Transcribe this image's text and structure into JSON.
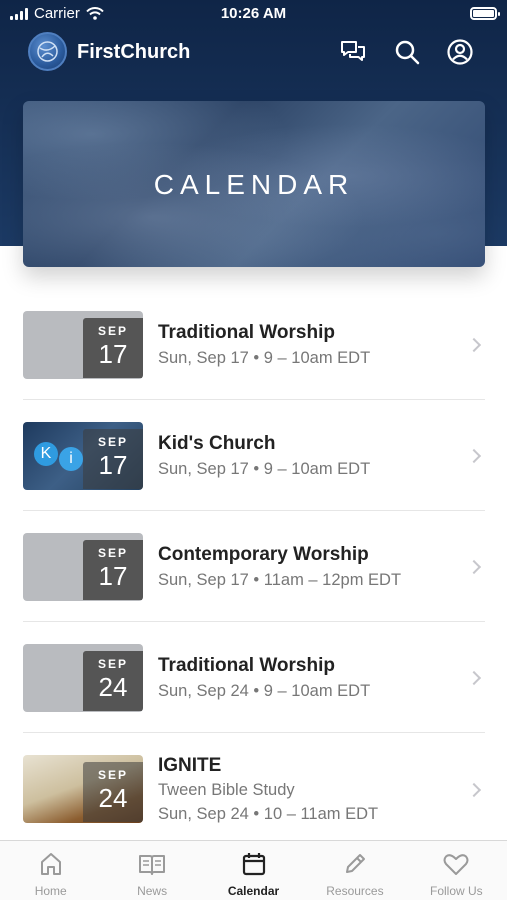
{
  "status_bar": {
    "carrier": "Carrier",
    "time": "10:26 AM"
  },
  "header": {
    "title": "FirstChurch"
  },
  "hero": {
    "title": "CALENDAR"
  },
  "events": [
    {
      "month": "SEP",
      "day": "17",
      "title": "Traditional Worship",
      "line1": "Sun, Sep 17 • 9 – 10am EDT",
      "line2": "",
      "thumb": "gray"
    },
    {
      "month": "SEP",
      "day": "17",
      "title": "Kid's Church",
      "line1": "Sun, Sep 17 • 9 – 10am EDT",
      "line2": "",
      "thumb": "kids",
      "thumb_text": [
        "K",
        "i"
      ]
    },
    {
      "month": "SEP",
      "day": "17",
      "title": "Contemporary Worship",
      "line1": "Sun, Sep 17 • 11am – 12pm EDT",
      "line2": "",
      "thumb": "gray"
    },
    {
      "month": "SEP",
      "day": "24",
      "title": "Traditional Worship",
      "line1": "Sun, Sep 24 • 9 – 10am EDT",
      "line2": "",
      "thumb": "gray"
    },
    {
      "month": "SEP",
      "day": "24",
      "title": "IGNITE",
      "line1": "Tween Bible Study",
      "line2": "Sun, Sep 24 • 10 – 11am EDT",
      "thumb": "ignite"
    }
  ],
  "tabs": [
    {
      "label": "Home",
      "icon": "home-icon"
    },
    {
      "label": "News",
      "icon": "news-icon"
    },
    {
      "label": "Calendar",
      "icon": "calendar-icon",
      "active": true
    },
    {
      "label": "Resources",
      "icon": "pencil-icon"
    },
    {
      "label": "Follow Us",
      "icon": "heart-icon"
    }
  ],
  "colors": {
    "header_bg": "#0f2547",
    "active_tab": "#222222",
    "inactive_tab": "#9a9a9a"
  }
}
